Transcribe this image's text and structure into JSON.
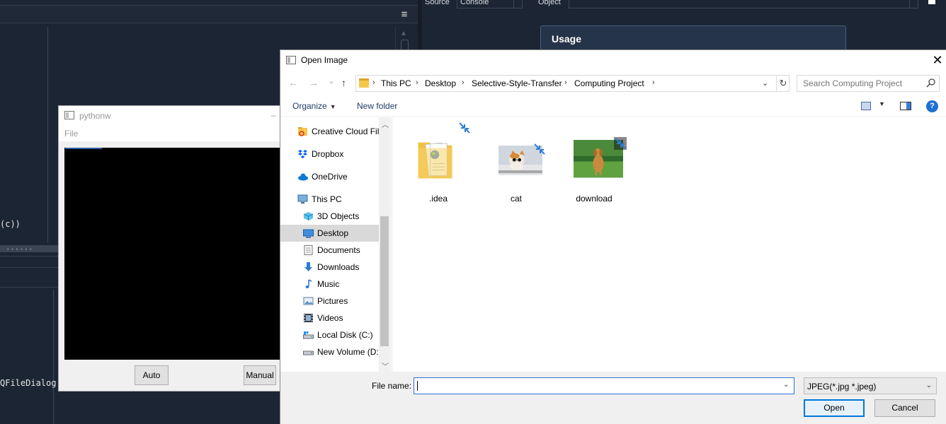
{
  "ide": {
    "code_line1": "(c))",
    "code_line2": "QFileDialog",
    "source_label": "Source",
    "source_value": "Console",
    "object_label": "Object",
    "usage_title": "Usage",
    "menu_icon": "hamburger-icon"
  },
  "pythonw": {
    "title": "pythonw",
    "minimize": "–",
    "menu_file": "File",
    "buttons": {
      "auto": "Auto",
      "manual": "Manual"
    }
  },
  "dialog": {
    "title": "Open Image",
    "close": "✕",
    "nav": {
      "back": "←",
      "forward": "→",
      "recent": "⌄",
      "up": "↑"
    },
    "breadcrumb": [
      "This PC",
      "Desktop",
      "Selective-Style-Transfer",
      "Computing Project"
    ],
    "search_placeholder": "Search Computing Project",
    "toolbar": {
      "organize": "Organize",
      "new_folder": "New folder",
      "help": "?"
    },
    "nav_items": [
      {
        "label": "Creative Cloud Fil",
        "icon": "creative-cloud-icon"
      },
      {
        "label": "Dropbox",
        "icon": "dropbox-icon"
      },
      {
        "label": "OneDrive",
        "icon": "onedrive-icon"
      },
      {
        "label": "This PC",
        "icon": "computer-icon"
      },
      {
        "label": "3D Objects",
        "icon": "cube-icon"
      },
      {
        "label": "Desktop",
        "icon": "desktop-icon",
        "selected": true
      },
      {
        "label": "Documents",
        "icon": "document-icon"
      },
      {
        "label": "Downloads",
        "icon": "download-arrow-icon"
      },
      {
        "label": "Music",
        "icon": "music-note-icon"
      },
      {
        "label": "Pictures",
        "icon": "picture-icon"
      },
      {
        "label": "Videos",
        "icon": "film-icon"
      },
      {
        "label": "Local Disk (C:)",
        "icon": "drive-icon"
      },
      {
        "label": "New Volume (D:",
        "icon": "drive-icon"
      }
    ],
    "files": [
      {
        "name": ".idea",
        "kind": "folder"
      },
      {
        "name": "cat",
        "kind": "image"
      },
      {
        "name": "download",
        "kind": "image"
      }
    ],
    "file_name_label": "File name:",
    "file_name_value": "",
    "file_type": "JPEG(*.jpg *.jpeg)",
    "open_label": "Open",
    "cancel_label": "Cancel"
  }
}
